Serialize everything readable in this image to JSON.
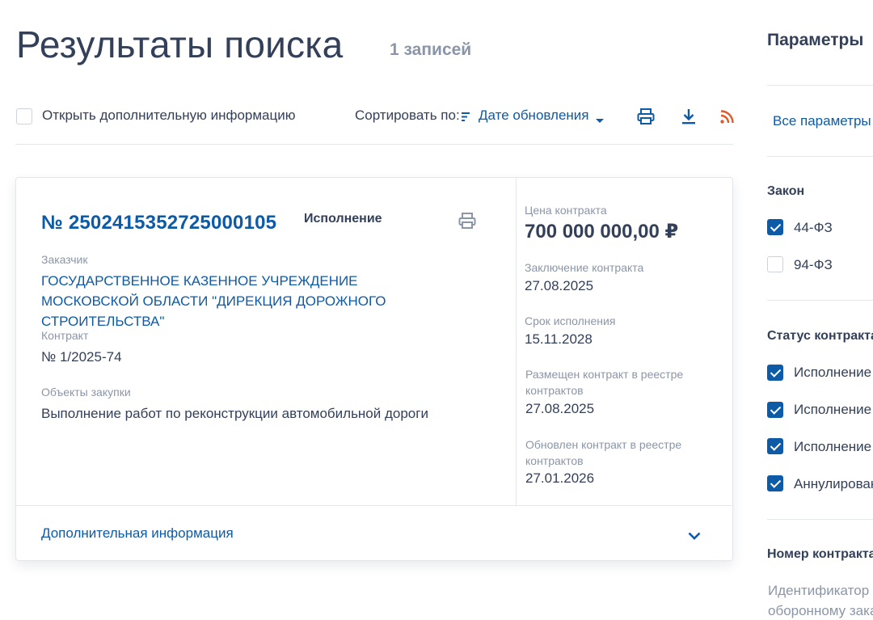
{
  "header": {
    "title": "Результаты поиска",
    "count": "1 записей"
  },
  "toolbar": {
    "extra_info_label": "Открыть дополнительную информацию",
    "sort_label": "Сортировать по:",
    "sort_value": "Дате обновления",
    "icons": [
      "print-icon",
      "download-icon",
      "rss-icon"
    ]
  },
  "card": {
    "number": "№ 2502415352725000105",
    "status": "Исполнение",
    "customer_label": "Заказчик",
    "customer_name": "ГОСУДАРСТВЕННОЕ КАЗЕННОЕ УЧРЕЖДЕНИЕ МОСКОВСКОЙ ОБЛАСТИ \"ДИРЕКЦИЯ ДОРОЖНОГО СТРОИТЕЛЬСТВА\"",
    "contract_label": "Контракт",
    "contract_value": "№ 1/2025-74",
    "objects_label": "Объекты закупки",
    "objects_value": "Выполнение работ по реконструкции автомобильной дороги",
    "price_label": "Цена контракта",
    "price_value": "700 000 000,00 ₽",
    "conclusion_label": "Заключение контракта",
    "conclusion_value": "27.08.2025",
    "term_label": "Срок исполнения",
    "term_value": "15.11.2028",
    "placed_label": "Размещен контракт в реестре контрактов",
    "placed_value": "27.08.2025",
    "updated_label": "Обновлен контракт в реестре контрактов",
    "updated_value": "27.01.2026",
    "more_info": "Дополнительная информация"
  },
  "panel": {
    "title": "Параметры",
    "all_params": "Все параметры",
    "law_title": "Закон",
    "laws": [
      {
        "label": "44-ФЗ",
        "checked": true
      },
      {
        "label": "94-ФЗ",
        "checked": false
      }
    ],
    "status_title": "Статус контракта",
    "statuses": [
      {
        "label": "Исполнение",
        "checked": true
      },
      {
        "label": "Исполнение",
        "checked": true
      },
      {
        "label": "Исполнение",
        "checked": true
      },
      {
        "label": "Аннулирован",
        "checked": true
      }
    ],
    "number_title": "Номер контракта",
    "hint_line1": "Идентификатор к",
    "hint_line2": "оборонному зака"
  },
  "colors": {
    "accent": "#0d5aa7",
    "text": "#334059",
    "muted": "#8a96a8",
    "rss": "#e05a2b"
  }
}
